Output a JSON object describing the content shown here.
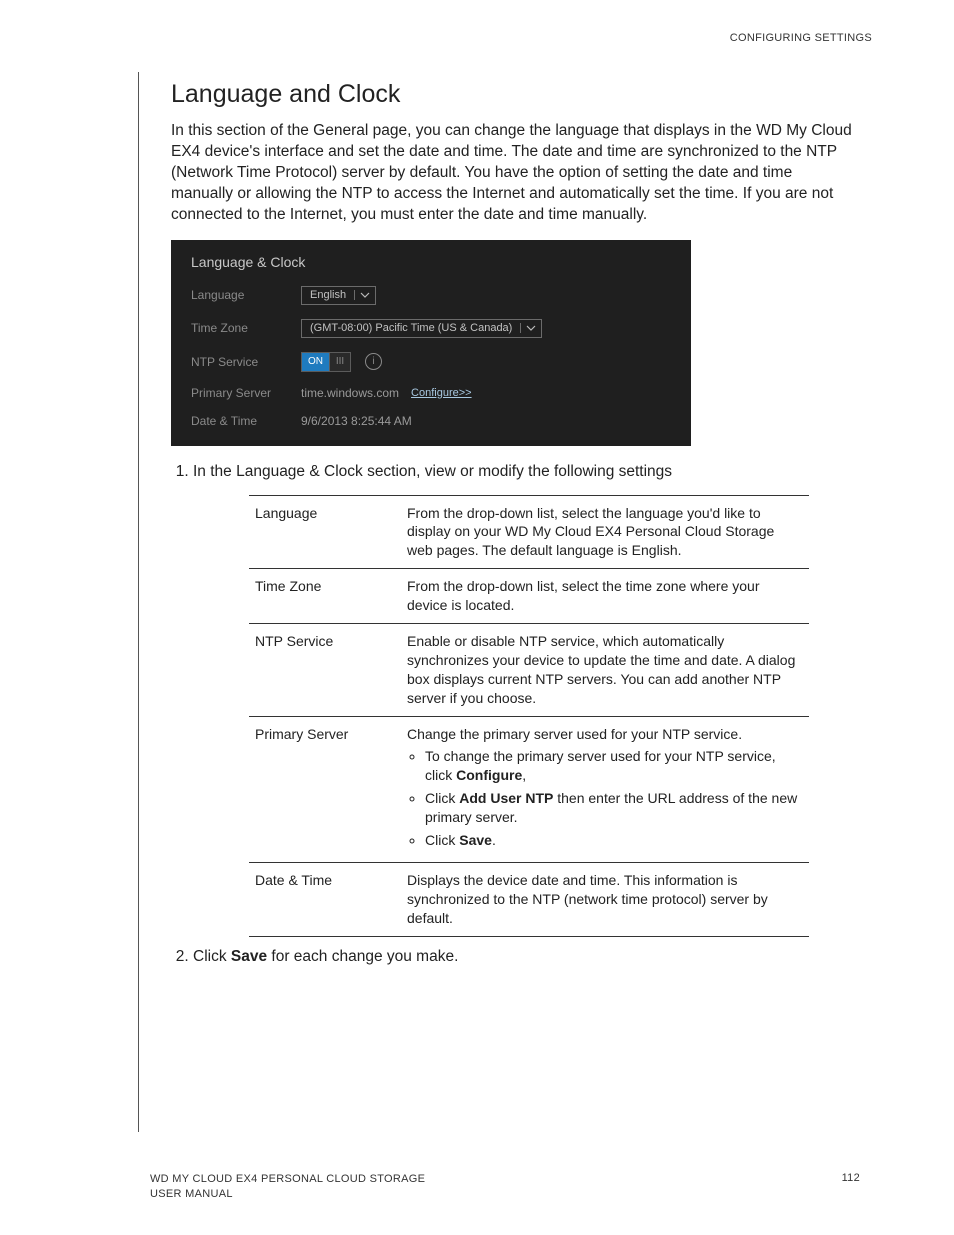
{
  "running_head": "CONFIGURING SETTINGS",
  "section_title": "Language and Clock",
  "intro": "In this section of the General page, you can change the language that displays in the WD My Cloud EX4 device's interface and set the date and time. The date and time are synchronized to the NTP (Network Time Protocol) server by default. You have the option of setting the date and time manually or allowing the NTP to access the Internet and automatically set the time. If you are not connected to the Internet, you must enter the date and time manually.",
  "panel": {
    "title": "Language & Clock",
    "language_label": "Language",
    "language_value": "English",
    "timezone_label": "Time Zone",
    "timezone_value": "(GMT-08:00) Pacific Time (US & Canada)",
    "ntp_label": "NTP Service",
    "toggle_on": "ON",
    "toggle_knob": "III",
    "info_glyph": "i",
    "primary_label": "Primary Server",
    "primary_value": "time.windows.com",
    "configure_link": "Configure>>",
    "datetime_label": "Date & Time",
    "datetime_value": "9/6/2013 8:25:44 AM"
  },
  "steps": {
    "s1": "In the Language & Clock section, view or modify the following settings",
    "s2_pre": "Click ",
    "s2_bold": "Save",
    "s2_post": " for each change you make."
  },
  "table": {
    "language": {
      "name": "Language",
      "desc": "From the drop-down list, select the language you'd like to display on your WD My Cloud EX4 Personal Cloud Storage web pages. The default language is English."
    },
    "timezone": {
      "name": "Time Zone",
      "desc": "From the drop-down list, select the time zone where your device is located."
    },
    "ntp": {
      "name": "NTP Service",
      "desc": "Enable or disable NTP service, which automatically synchronizes your device to update the time and date. A dialog box displays current NTP servers. You can add another NTP server if you choose."
    },
    "primary": {
      "name": "Primary Server",
      "desc": "Change the primary server used for your NTP service.",
      "b1_pre": "To change the primary server used for your NTP service, click ",
      "b1_bold": "Configure",
      "b1_post": ",",
      "b2_pre": "Click ",
      "b2_bold": "Add User NTP",
      "b2_post": " then enter the URL address of the new primary server.",
      "b3_pre": "Click ",
      "b3_bold": "Save",
      "b3_post": "."
    },
    "datetime": {
      "name": "Date & Time",
      "desc": "Displays the device date and time. This information is synchronized to the NTP (network time protocol) server by default."
    }
  },
  "footer": {
    "line1": "WD MY CLOUD EX4 PERSONAL CLOUD STORAGE",
    "line2": "USER MANUAL",
    "page": "112"
  }
}
